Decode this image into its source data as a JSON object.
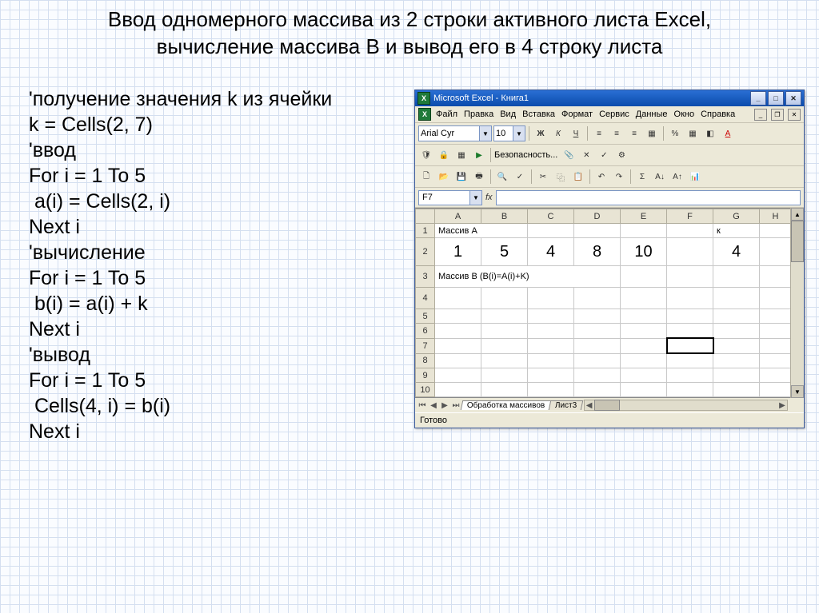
{
  "heading_line1": "Ввод одномерного массива из 2 строки активного листа Excel,",
  "heading_line2": "вычисление массива В и вывод его в 4 строку листа",
  "code": [
    "'получение значения k из ячейки",
    "k = Cells(2, 7)",
    "'ввод",
    "For i = 1 To 5",
    " a(i) = Cells(2, i)",
    "Next i",
    "",
    "'вычисление",
    "For i = 1 To 5",
    " b(i) = a(i) + k",
    "Next i",
    "",
    "'вывод",
    "For i = 1 To 5",
    " Cells(4, i) = b(i)",
    "Next i"
  ],
  "excel": {
    "title": "Microsoft Excel - Книга1",
    "menu": [
      "Файл",
      "Правка",
      "Вид",
      "Вставка",
      "Формат",
      "Сервис",
      "Данные",
      "Окно",
      "Справка"
    ],
    "font_name": "Arial Cyr",
    "font_size": "10",
    "security_label": "Безопасность...",
    "namebox": "F7",
    "columns": [
      "A",
      "B",
      "C",
      "D",
      "E",
      "F",
      "G",
      "H"
    ],
    "row_heads": [
      "1",
      "2",
      "3",
      "4",
      "5",
      "6",
      "7",
      "8",
      "9",
      "10"
    ],
    "row1_a": "Массив А",
    "row1_g": "к",
    "row2": [
      "1",
      "5",
      "4",
      "8",
      "10",
      "",
      "4",
      ""
    ],
    "row3_a": "Массив В (B(i)=A(i)+K)",
    "selected_cell": "F7",
    "tabs": [
      "Обработка массивов",
      "Лист3"
    ],
    "status": "Готово"
  }
}
